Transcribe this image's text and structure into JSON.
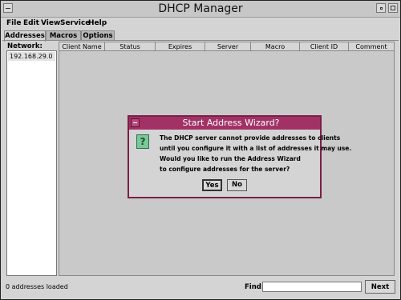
{
  "window": {
    "title": "DHCP Manager"
  },
  "menu": [
    "File",
    "Edit",
    "View",
    "Service",
    "Help"
  ],
  "tabs": [
    {
      "label": "Addresses",
      "active": true
    },
    {
      "label": "Macros",
      "active": false
    },
    {
      "label": "Options",
      "active": false
    }
  ],
  "network": {
    "label": "Network:",
    "items": [
      "192.168.29.0"
    ]
  },
  "table": {
    "columns": [
      "Client Name",
      "Status",
      "Expires",
      "Server",
      "Macro",
      "Client ID",
      "Comment"
    ],
    "rows": []
  },
  "statusbar": {
    "status": "0 addresses loaded",
    "find_label": "Find:",
    "find_value": "",
    "next_label": "Next"
  },
  "dialog": {
    "title": "Start Address Wizard?",
    "icon": "question-icon",
    "lines": [
      "The DHCP server cannot provide addresses to clients",
      "until you configure it with a list of addresses it may use.",
      "Would you like to run the Address Wizard",
      "to configure addresses for the server?"
    ],
    "yes_label": "Yes",
    "no_label": "No"
  },
  "colors": {
    "dialog_titlebar": "#a23266",
    "dialog_border": "#7a1f49",
    "window_bg": "#d4d4d4"
  }
}
